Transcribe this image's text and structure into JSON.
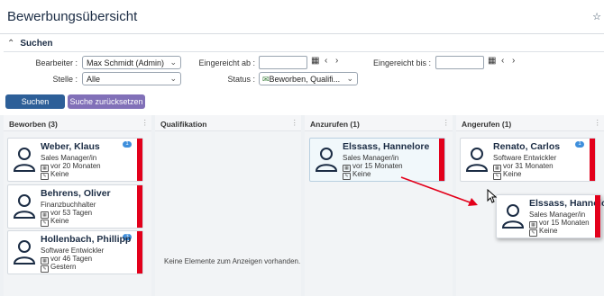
{
  "page": {
    "title": "Bewerbungsübersicht"
  },
  "search": {
    "toggle_label": "Suchen",
    "bearbeiter_label": "Bearbeiter :",
    "bearbeiter_value": "Max Schmidt (Admin)",
    "stelle_label": "Stelle :",
    "stelle_value": "Alle",
    "eingereicht_ab_label": "Eingereicht ab :",
    "eingereicht_ab_value": "",
    "eingereicht_bis_label": "Eingereicht bis :",
    "eingereicht_bis_value": "",
    "status_label": "Status :",
    "status_value": "Beworben, Qualifi...",
    "search_button": "Suchen",
    "reset_button": "Suche zurücksetzen"
  },
  "board": {
    "columns": [
      {
        "title": "Beworben (3)"
      },
      {
        "title": "Qualifikation",
        "empty_text": "Keine Elemente zum Anzeigen vorhanden."
      },
      {
        "title": "Anzurufen (1)"
      },
      {
        "title": "Angerufen (1)"
      }
    ],
    "cards": [
      {
        "name": "Weber, Klaus",
        "position": "Sales Manager/in",
        "since": "vor 20 Monaten",
        "note": "Keine",
        "badge": "1"
      },
      {
        "name": "Behrens, Oliver",
        "position": "Finanzbuchhalter",
        "since": "vor 53 Tagen",
        "note": "Keine"
      },
      {
        "name": "Hollenbach, Phillipp",
        "position": "Software Entwickler",
        "since": "vor 46 Tagen",
        "note": "Gestern",
        "badge": "3"
      },
      {
        "name": "Elssass, Hannelore",
        "position": "Sales Manager/in",
        "since": "vor 15 Monaten",
        "note": "Keine"
      },
      {
        "name": "Renato, Carlos",
        "position": "Software Entwickler",
        "since": "vor 31 Monaten",
        "note": "Keine",
        "badge": "1"
      },
      {
        "name": "Elssass, Hannelore",
        "position": "Sales Manager/in",
        "since": "vor 15 Monaten",
        "note": "Keine"
      }
    ]
  },
  "colors": {
    "primary": "#2d5f98",
    "secondary": "#8170b8",
    "flag": "#e3001b",
    "badge": "#3f8fdc",
    "arrow": "#e3001b"
  },
  "icons": [
    "star-icon",
    "chevron-up-icon",
    "chevron-down-icon",
    "calendar-icon",
    "chevron-left-icon",
    "chevron-right-icon",
    "envelope-icon",
    "person-icon",
    "drag-handle-icon",
    "mouse-cursor-icon"
  ]
}
